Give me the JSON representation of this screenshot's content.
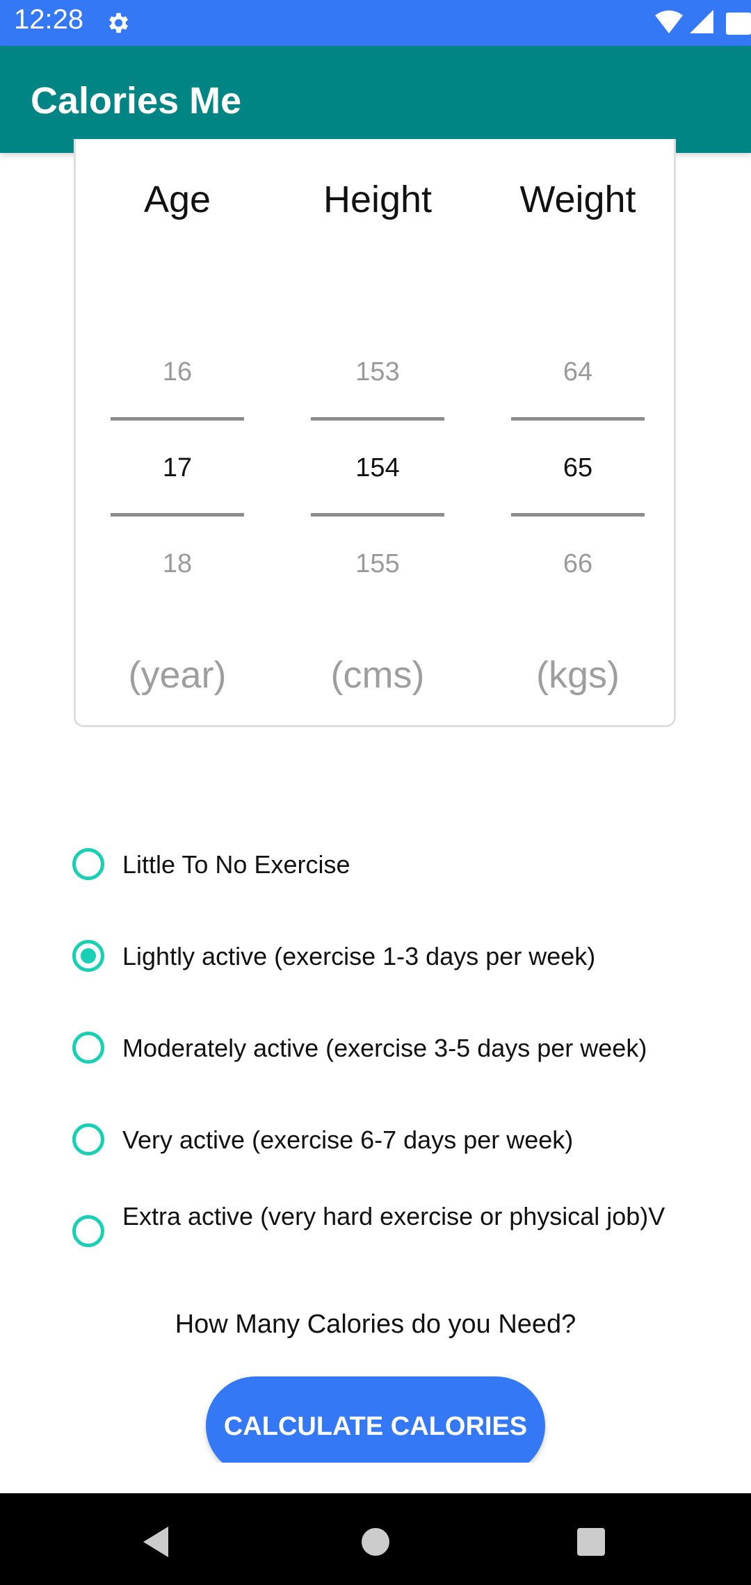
{
  "status_bar": {
    "time": "12:28"
  },
  "app_bar": {
    "title": "Calories Me"
  },
  "pickers": [
    {
      "header": "Age",
      "prev": "16",
      "selected": "17",
      "next": "18",
      "unit": "(year)"
    },
    {
      "header": "Height",
      "prev": "153",
      "selected": "154",
      "next": "155",
      "unit": "(cms)"
    },
    {
      "header": "Weight",
      "prev": "64",
      "selected": "65",
      "next": "66",
      "unit": "(kgs)"
    }
  ],
  "activity_options": [
    {
      "label": "Little To No Exercise",
      "checked": false
    },
    {
      "label": "Lightly active (exercise 1-3 days per week)",
      "checked": true
    },
    {
      "label": "Moderately active (exercise 3-5 days per week)",
      "checked": false
    },
    {
      "label": "Very active (exercise 6-7 days per week)",
      "checked": false
    },
    {
      "label": "Extra active (very hard exercise or physical job)V",
      "checked": false
    }
  ],
  "question": "How Many Calories do you Need?",
  "calculate_button": "CALCULATE CALORIES",
  "colors": {
    "status_bar": "#3478f6",
    "app_bar": "#008484",
    "radio_accent": "#19cfb4",
    "button": "#3478f6"
  },
  "icons": {
    "status": [
      "gear-icon",
      "wifi-icon",
      "signal-icon",
      "battery-icon"
    ],
    "nav": [
      "back-icon",
      "home-icon",
      "recents-icon"
    ]
  }
}
